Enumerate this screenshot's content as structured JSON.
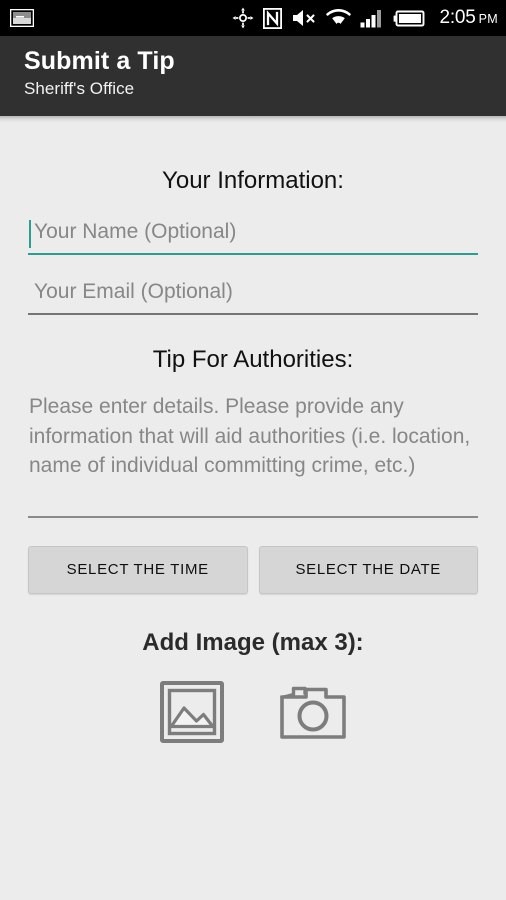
{
  "statusbar": {
    "notification_icon": "screenshot-image-icon",
    "icons": [
      "gps-location-icon",
      "nfc-icon",
      "volume-muted-icon",
      "wifi-icon",
      "cellular-signal-icon",
      "battery-icon"
    ],
    "time": "2:05",
    "meridiem": "PM"
  },
  "appbar": {
    "title": "Submit a Tip",
    "subtitle": "Sheriff's Office",
    "background_color": "#303030"
  },
  "form": {
    "information_heading": "Your Information:",
    "name_field": {
      "placeholder": "Your Name (Optional)",
      "value": "",
      "focused": true,
      "accent_color": "#2b9e92"
    },
    "email_field": {
      "placeholder": "Your Email (Optional)",
      "value": "",
      "focused": false,
      "underline_color": "#757575"
    },
    "tip_heading": "Tip For Authorities:",
    "tip_field": {
      "placeholder": "Please enter details. Please provide any information that will aid authorities (i.e. location, name of individual committing crime, etc.)",
      "value": ""
    },
    "select_time_button": "SELECT THE TIME",
    "select_date_button": "SELECT THE DATE"
  },
  "add_image": {
    "heading": "Add Image (max 3):",
    "gallery_icon": "gallery-picture-icon",
    "camera_icon": "camera-icon",
    "icon_color": "#7d7d7d"
  }
}
